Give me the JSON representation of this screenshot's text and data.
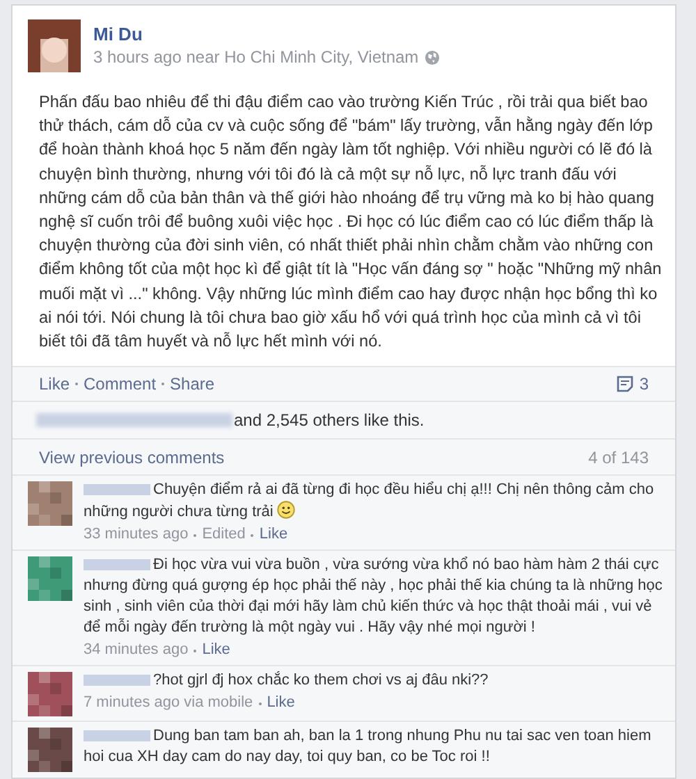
{
  "post": {
    "author": "Mi Du",
    "meta": "3 hours ago near Ho Chi Minh City, Vietnam",
    "body": "Phấn đấu bao nhiêu để thi đậu điểm cao vào trường Kiến Trúc , rồi trải qua biết bao thử thách, cám dỗ của cv và cuộc sống để \"bám\" lấy trường, vẫn hằng ngày đến lớp để hoàn thành khoá học 5 năm đến ngày làm tốt nghiệp. Với nhiều người có lẽ đó là chuyện bình thường, nhưng với tôi đó là cả một sự nỗ lực, nỗ lực tranh đấu với những cám dỗ của bản thân và thế giới hào nhoáng để trụ vững mà ko bị hào quang nghệ sĩ cuốn trôi để buông xuôi việc học . Đi học có lúc điểm cao có lúc điểm thấp là chuyện thường của đời sinh viên, có nhất thiết phải nhìn chằm chằm vào những con điểm không tốt của một học kì để giật tít là \"Học vấn đáng sợ \" hoặc \"Những mỹ nhân muối mặt vì ...\" không. Vậy những lúc mình điểm cao hay được nhận học bổng thì ko ai nói tới. Nói chung là tôi chưa bao giờ xấu hổ với quá trình học của mình cả vì tôi biết tôi đã tâm huyết và nỗ lực hết mình với nó."
  },
  "actions": [
    "Like",
    "Comment",
    "Share"
  ],
  "comment_count": "3",
  "likes": "and 2,545 others like this.",
  "view_previous": "View previous comments",
  "comment_range": "4 of 143",
  "comments": [
    {
      "color": "#a08070",
      "text": "Chuyện điểm rả ai đã từng đi học đều hiểu chị ạ!!! Chị nên thông cảm cho những người chưa từng trải",
      "smiley": true,
      "meta": [
        "33 minutes ago",
        "Edited",
        "Like"
      ]
    },
    {
      "color": "#3f9a78",
      "text": "Đi học vừa vui vừa buồn , vừa sướng vừa khổ nó bao hàm hàm 2 thái cực nhưng đừng quá gượng ép học phải thế này , học phải thế kia chúng ta là những học sinh , sinh viên của thời đại mới hãy làm chủ kiến thức và học thật thoải mái , vui vẻ để mỗi ngày đến trường là một ngày vui . Hãy vậy nhé mọi người !",
      "smiley": false,
      "meta": [
        "34 minutes ago",
        "Like"
      ]
    },
    {
      "color": "#a0505a",
      "text": "?hot gjrl đj hox chắc ko them chơi vs aj đâu nki??",
      "smiley": false,
      "meta": [
        "7 minutes ago via mobile",
        "Like"
      ]
    },
    {
      "color": "#6a4a48",
      "text": "Dung ban tam ban ah, ban la 1 trong nhung Phu nu tai sac ven toan hiem hoi cua XH day cam do nay day, toi quy ban, co be Toc roi !!",
      "smiley": false
    }
  ]
}
